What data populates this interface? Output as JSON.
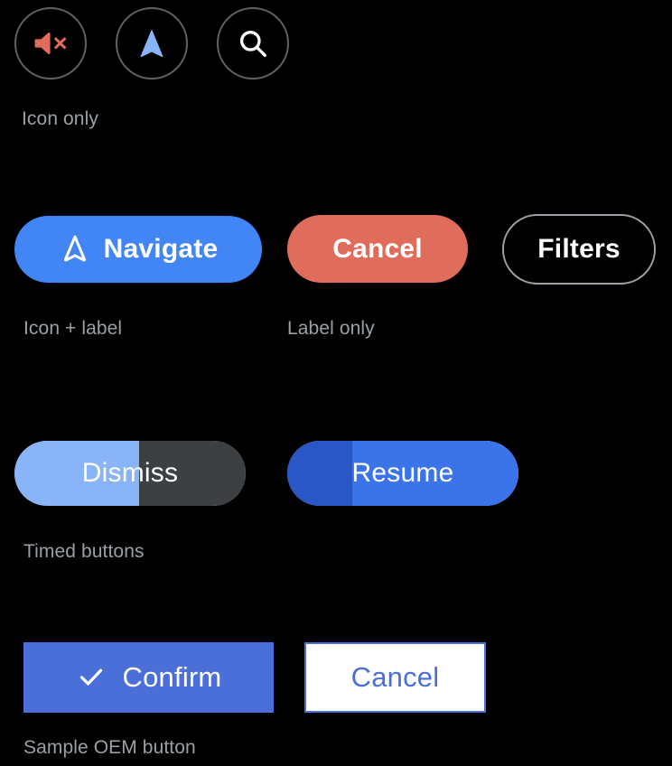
{
  "theme": {
    "background": "#000000",
    "accent_blue": "#4285f4",
    "accent_blue_light": "#8ab4f8",
    "accent_blue_dark": "#2a56c6",
    "accent_red": "#e06c5c",
    "outline_gray": "#9aa0a6",
    "track_gray": "#3c4043",
    "oem_blue": "#4a6fd8",
    "text_white": "#ffffff",
    "caption_gray": "#9aa0a6"
  },
  "rows": {
    "icon_only": {
      "caption": "Icon only",
      "buttons": [
        {
          "name": "mute-button",
          "icon": "volume-off-icon",
          "color": "#e06c5c"
        },
        {
          "name": "navigate-button",
          "icon": "navigation-arrow-icon",
          "color": "#8ab4f8"
        },
        {
          "name": "search-button",
          "icon": "search-icon",
          "color": "#ffffff"
        }
      ]
    },
    "icon_label": {
      "caption": "Icon + label",
      "button": {
        "label": "Navigate",
        "icon": "navigation-arrow-outline-icon",
        "background": "#4285f4",
        "text_color": "#ffffff"
      }
    },
    "label_only": {
      "caption": "Label only",
      "buttons": [
        {
          "label": "Cancel",
          "background": "#e06c5c",
          "text_color": "#ffffff",
          "style": "filled"
        },
        {
          "label": "Filters",
          "background": "#000000",
          "text_color": "#ffffff",
          "style": "outlined",
          "border_color": "#9aa0a6"
        }
      ]
    },
    "timed": {
      "caption": "Timed buttons",
      "buttons": [
        {
          "label": "Dismiss",
          "progress_percent": 54,
          "progress_color": "#8ab4f8",
          "track_color": "#3c4043",
          "text_color": "#ffffff"
        },
        {
          "label": "Resume",
          "progress_percent": 28,
          "progress_color": "#2a56c6",
          "track_color": "#3b73e8",
          "text_color": "#ffffff"
        }
      ]
    },
    "oem": {
      "caption": "Sample OEM button",
      "buttons": [
        {
          "label": "Confirm",
          "icon": "check-icon",
          "background": "#4a6fd8",
          "text_color": "#ffffff",
          "style": "filled"
        },
        {
          "label": "Cancel",
          "background": "#ffffff",
          "text_color": "#4a6fd8",
          "style": "outlined",
          "border_color": "#4a6fd8"
        }
      ]
    }
  }
}
